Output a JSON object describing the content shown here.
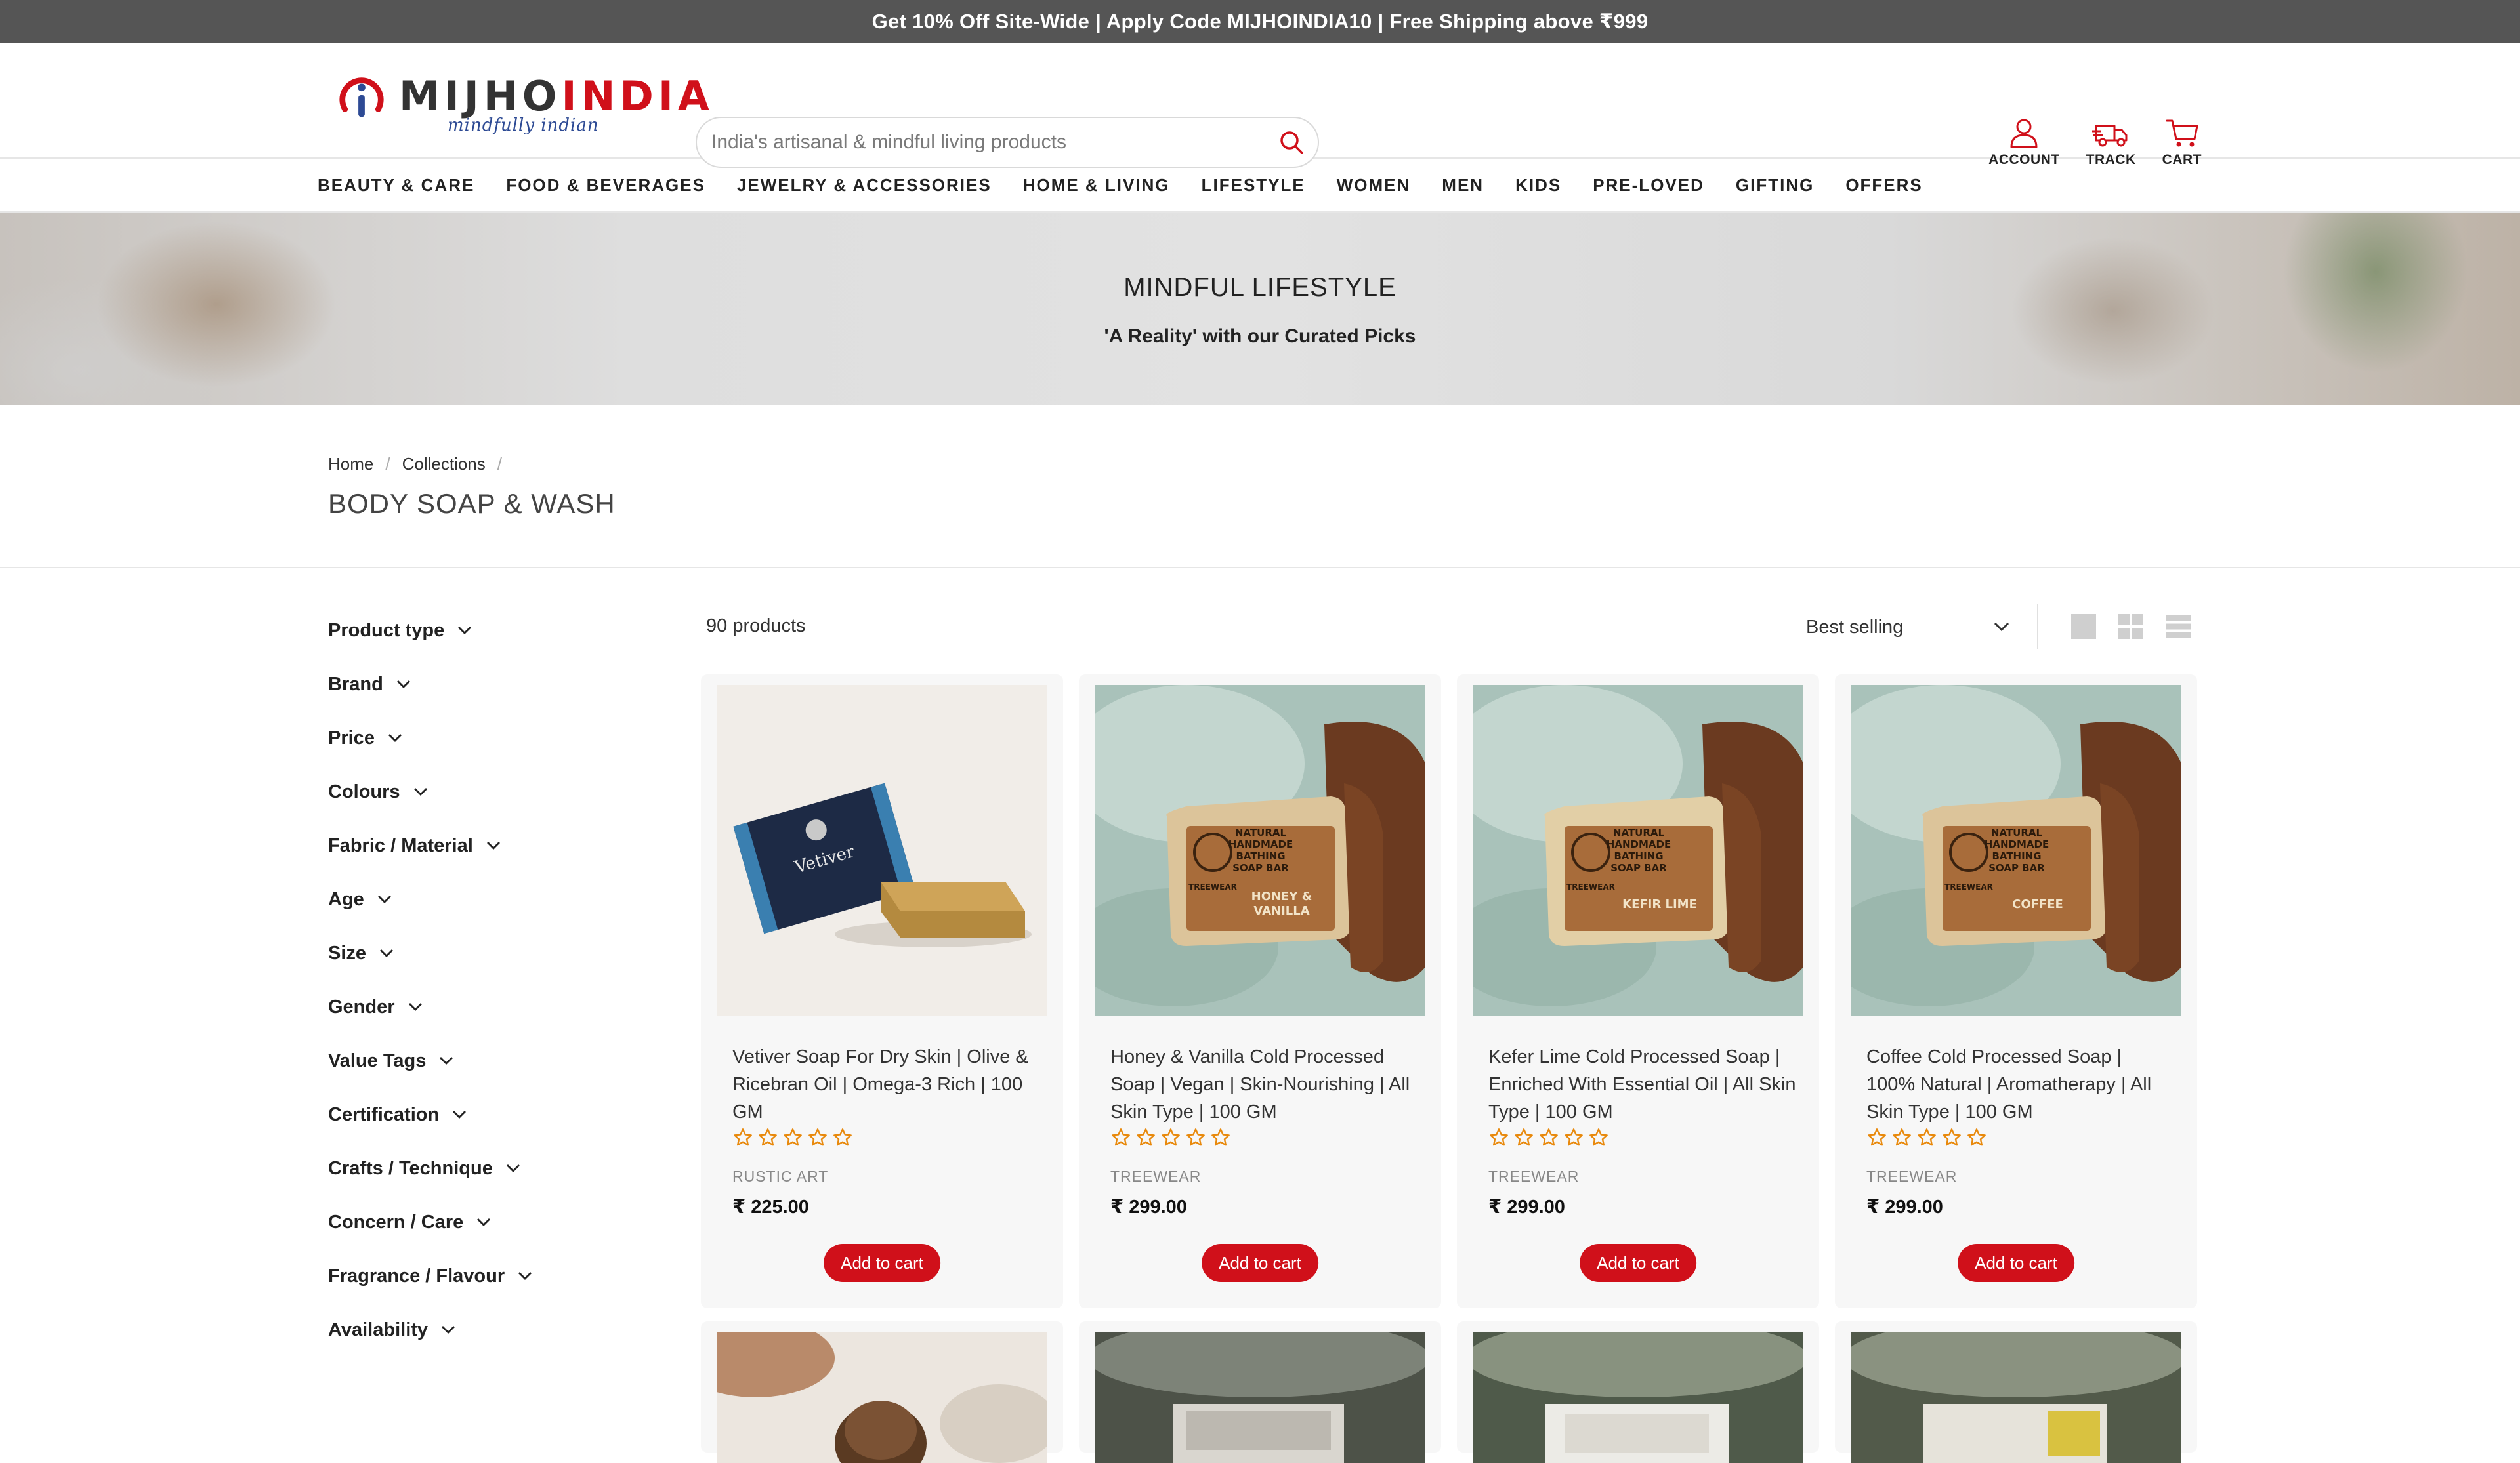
{
  "announcement": "Get 10% Off Site-Wide | Apply Code MIJHOINDIA10 | Free Shipping above ₹999",
  "brand": {
    "name_part1": "MIJHO",
    "name_part2": "INDIA",
    "tagline": "mindfully indian"
  },
  "search": {
    "placeholder": "India's artisanal & mindful living products",
    "icon": "search-icon"
  },
  "header_icons": [
    {
      "label": "ACCOUNT",
      "icon": "user-icon"
    },
    {
      "label": "TRACK",
      "icon": "truck-icon"
    },
    {
      "label": "CART",
      "icon": "cart-icon"
    }
  ],
  "nav": [
    "BEAUTY & CARE",
    "FOOD & BEVERAGES",
    "JEWELRY & ACCESSORIES",
    "HOME & LIVING",
    "LIFESTYLE",
    "WOMEN",
    "MEN",
    "KIDS",
    "PRE-LOVED",
    "GIFTING",
    "OFFERS"
  ],
  "hero": {
    "title": "MINDFUL LIFESTYLE",
    "subtitle": "'A Reality' with our Curated Picks"
  },
  "breadcrumb": [
    "Home",
    "Collections"
  ],
  "page_title": "BODY SOAP & WASH",
  "filters": [
    "Product type",
    "Brand",
    "Price",
    "Colours",
    "Fabric / Material",
    "Age",
    "Size",
    "Gender",
    "Value Tags",
    "Certification",
    "Crafts / Technique",
    "Concern / Care",
    "Fragrance / Flavour",
    "Availability"
  ],
  "toolbar": {
    "count": "90 products",
    "sort": "Best selling"
  },
  "colors": {
    "accent": "#d0101a",
    "announcement_bg": "#555555",
    "star": "#e8890c"
  },
  "products": [
    {
      "title": "Vetiver Soap For Dry Skin | Olive & Ricebran Oil | Omega-3 Rich | 100 GM",
      "vendor": "RUSTIC ART",
      "price": "₹ 225.00",
      "rating": 0,
      "button": "Add to cart"
    },
    {
      "title": "Honey & Vanilla Cold Processed Soap | Vegan | Skin-Nourishing | All Skin Type | 100 GM",
      "vendor": "TREEWEAR",
      "price": "₹ 299.00",
      "rating": 0,
      "button": "Add to cart"
    },
    {
      "title": "Kefer Lime Cold Processed Soap | Enriched With Essential Oil | All Skin Type | 100 GM",
      "vendor": "TREEWEAR",
      "price": "₹ 299.00",
      "rating": 0,
      "button": "Add to cart"
    },
    {
      "title": "Coffee Cold Processed Soap | 100% Natural | Aromatherapy | All Skin Type | 100 GM",
      "vendor": "TREEWEAR",
      "price": "₹ 299.00",
      "rating": 0,
      "button": "Add to cart"
    }
  ],
  "product_images": {
    "vetiver_box_label": "Vetiver",
    "soap_labels": [
      [
        "NATURAL",
        "HANDMADE",
        "BATHING",
        "SOAP BAR",
        "HONEY &",
        "VANILLA"
      ],
      [
        "NATURAL",
        "HANDMADE",
        "BATHING",
        "SOAP BAR",
        "KEFIR LIME"
      ],
      [
        "NATURAL",
        "HANDMADE",
        "BATHING",
        "SOAP BAR",
        "COFFEE"
      ]
    ],
    "soap_brand": "TREEWEAR"
  }
}
